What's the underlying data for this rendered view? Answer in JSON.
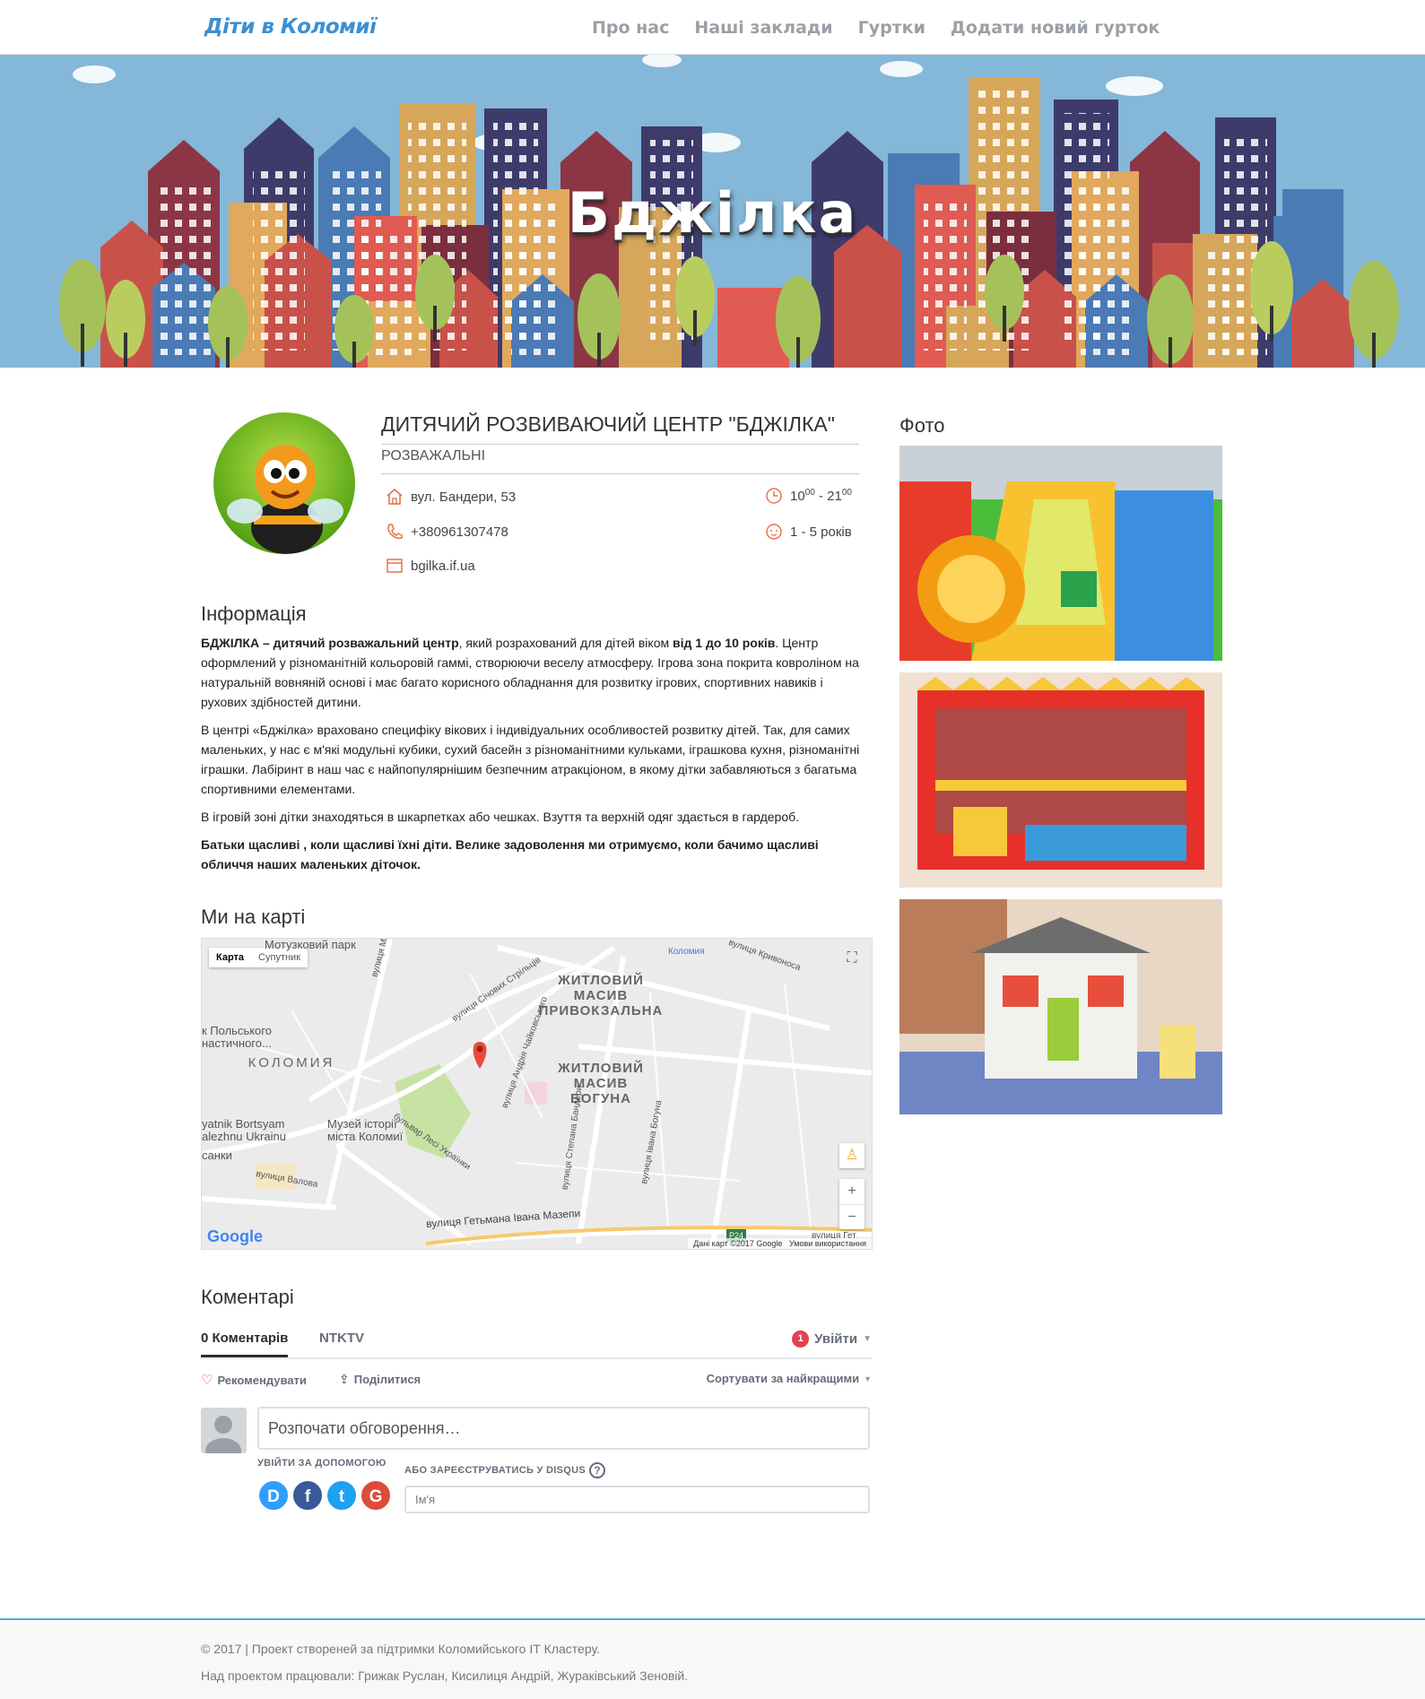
{
  "brand": "Діти в Коломиї",
  "nav": [
    "Про нас",
    "Наші заклади",
    "Гуртки",
    "Додати новий гурток"
  ],
  "hero_title": "Бджілка",
  "center": {
    "title": "ДИТЯЧИЙ РОЗВИВАЮЧИЙ ЦЕНТР \"БДЖІЛКА\"",
    "type": "РОЗВАЖАЛЬНІ",
    "address": "вул. Бандери, 53",
    "phone": "+380961307478",
    "website": "bgilka.if.ua",
    "hours_open": "10",
    "hours_open_sup": "00",
    "hours_sep": " - ",
    "hours_close": "21",
    "hours_close_sup": "00",
    "ages": "1 - 5 років"
  },
  "info": {
    "heading": "Інформація",
    "p1_b1": "БДЖІЛКА – дитячий розважальний центр",
    "p1_t1": ", який розрахований для дітей віком ",
    "p1_b2": "від 1 до 10 років",
    "p1_t2": ". Центр оформлений у різноманітній кольоровій гаммі, створюючи веселу атмосферу. Ігрова зона покрита ковроліном на натуральній вовняній основі і має багато корисного обладнання для розвитку ігрових, спортивних навиків і рухових здібностей дитини.",
    "p2": "В центрі «Бджілка» враховано специфіку вікових і індивідуальних особливостей розвитку дітей. Так, для самих маленьких, у нас є м'які модульні кубики, сухий басейн з різноманітними кульками, іграшкова кухня, різноманітні іграшки. Лабіринт в наш час є найпопулярнішим безпечним атракціоном, в якому дітки забавляються з багатьма спортивними елементами.",
    "p3": "В ігровій зоні дітки знаходяться в шкарпетках або чешках. Взуття та верхній одяг здається в гардероб.",
    "p4": "Батьки щасливі , коли щасливі їхні діти. Велике задоволення ми отримуємо, коли бачимо щасливі обличчя наших маленьких діточок."
  },
  "map": {
    "heading": "Ми на карті",
    "tab_map": "Карта",
    "tab_satellite": "Супутник",
    "label_park": "Мотузковий парк",
    "label_prv": "ЖИТЛОВИЙ МАСИВ ПРИВОКЗАЛЬНА",
    "label_bog": "ЖИТЛОВИЙ МАСИВ БОГУНА",
    "label_city": "Коломия",
    "label_pol": "к Польського настичного...",
    "label_museum": "Музей історії міста Коломиї",
    "label_bortsyam": "yatnik Bortsyam alezhnu Ukrainu",
    "label_sanky": "санки",
    "label_kolomyia": "Коломия",
    "road_mazepa": "вулиця Гетьмана Івана Мазепи",
    "road_sichovyh": "вулиця Січових Стрільців",
    "road_chaikovskoho": "вулиця Андрія Чайковського",
    "road_bandery": "вулиця Степана Бандери",
    "road_lesi": "бульвар Лесі Українки",
    "road_valova": "вулиця Валова",
    "road_bohuna": "вулиця Івана Богуна",
    "road_kryvonosa": "вулиця Кривоноса",
    "road_mi": "вулиця Ми",
    "road_get": "вулиця Гет",
    "route_badge": "P24",
    "fullscreen": "⛶",
    "pegman": "♙",
    "zoom_in": "+",
    "zoom_out": "−",
    "google": "Google",
    "footer_data": "Дані карт ©2017 Google",
    "footer_terms": "Умови використання"
  },
  "photos_heading": "Фото",
  "comments": {
    "heading": "Коментарі",
    "tab_count": "0 Коментарів",
    "tab_site": "NTKTV",
    "badge": "1",
    "login": "Увійти",
    "recommend": "Рекомендувати",
    "share": "Поділитися",
    "sort": "Сортувати за найкращими",
    "placeholder": "Розпочати обговорення…",
    "login_with": "УВІЙТИ ЗА ДОПОМОГОЮ",
    "or_register": "АБО ЗАРЕЄСТРУВАТИСЬ У DISQUS",
    "help": "?",
    "name_placeholder": "Ім'я",
    "social": [
      "D",
      "f",
      "t",
      "G"
    ]
  },
  "footer": {
    "line1": "© 2017 | Проект створеней за підтримки Коломийського ІТ Кластеру.",
    "line2": "Над проектом працювали: Грижак Руслан, Кисилиця Андрій, Жураківський Зеновій."
  },
  "colors": {
    "brand": "#3d8fd1",
    "sky": "#84b7d8",
    "footer_border": "#5ea6d8",
    "disqus_red": "#e3404f"
  }
}
